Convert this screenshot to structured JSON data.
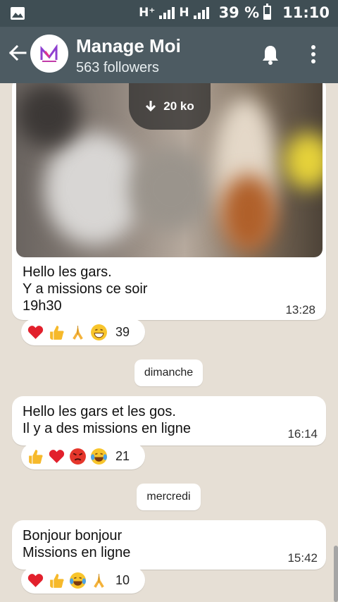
{
  "statusbar": {
    "net1": "H⁺",
    "net2": "H",
    "battery": "39 %",
    "time": "11:10"
  },
  "header": {
    "title": "Manage Moi",
    "subtitle": "563 followers"
  },
  "media": {
    "download_label": "20 ko"
  },
  "messages": [
    {
      "text": "Hello les gars.\nY a missions ce soir\n19h30",
      "time": "13:28",
      "reactions": [
        "heart",
        "thumbs-up",
        "folded-hands",
        "grinning-face"
      ],
      "reaction_count": "39"
    },
    {
      "text": "Hello les gars et les gos.\nIl y a des missions en ligne",
      "time": "16:14",
      "reactions": [
        "thumbs-up",
        "heart",
        "angry-face",
        "tears-of-joy-face"
      ],
      "reaction_count": "21"
    },
    {
      "text": "Bonjour bonjour\nMissions en ligne",
      "time": "15:42",
      "reactions": [
        "heart",
        "thumbs-up",
        "tears-of-joy-face",
        "folded-hands"
      ],
      "reaction_count": "10"
    }
  ],
  "dates": [
    "dimanche",
    "mercredi"
  ],
  "colors": {
    "statusbar": "#3f4e54",
    "header": "#4d5b62",
    "background": "#e6dfd5",
    "bubble": "#ffffff",
    "heart": "#e2202c",
    "thumb": "#f6b92b"
  }
}
